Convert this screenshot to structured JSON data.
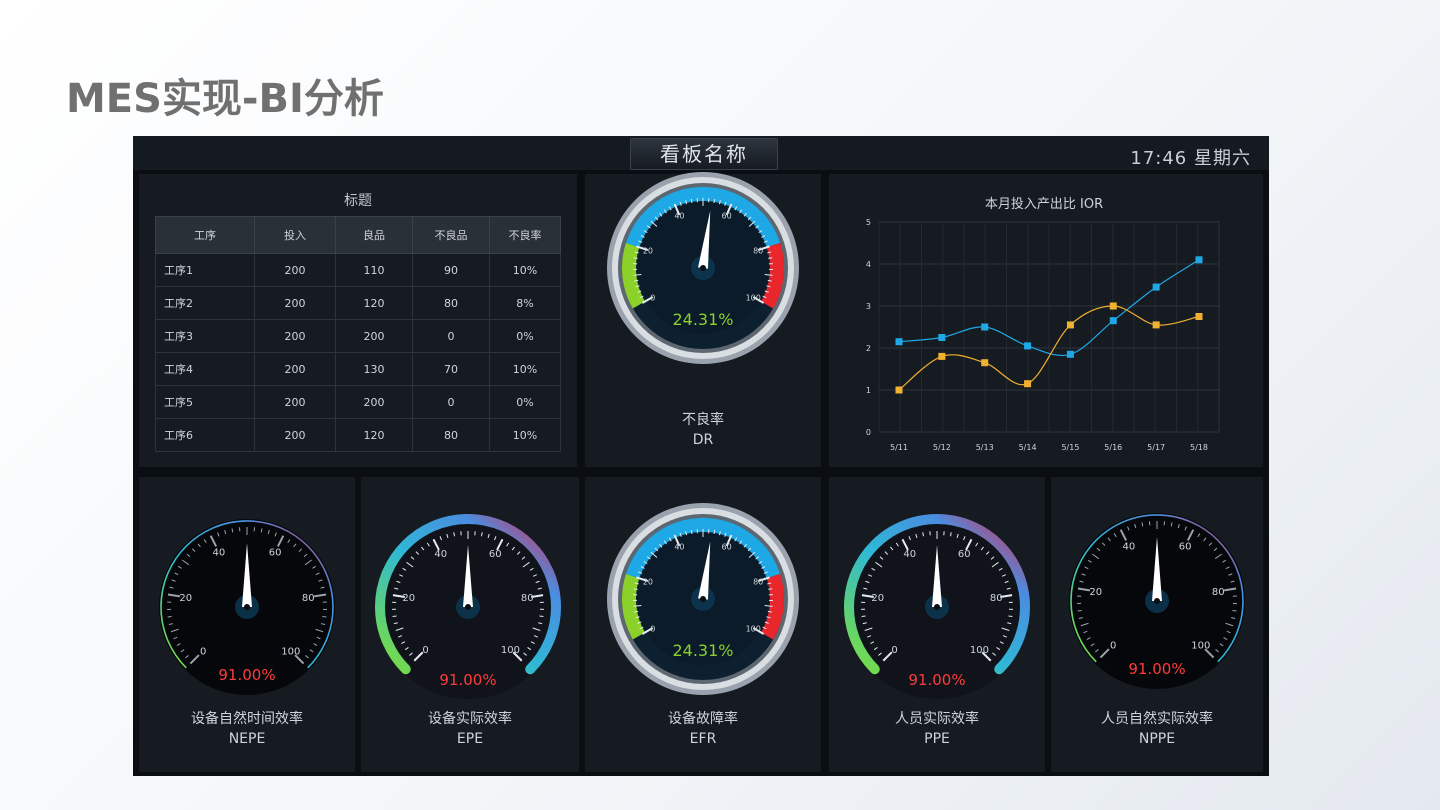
{
  "slide": {
    "title": "MES实现-BI分析"
  },
  "header": {
    "board_title": "看板名称",
    "clock": "17:46 星期六"
  },
  "table": {
    "title": "标题",
    "columns": [
      "工序",
      "投入",
      "良品",
      "不良品",
      "不良率"
    ],
    "rows": [
      [
        "工序1",
        "200",
        "110",
        "90",
        "10%"
      ],
      [
        "工序2",
        "200",
        "120",
        "80",
        "8%"
      ],
      [
        "工序3",
        "200",
        "200",
        "0",
        "0%"
      ],
      [
        "工序4",
        "200",
        "130",
        "70",
        "10%"
      ],
      [
        "工序5",
        "200",
        "200",
        "0",
        "0%"
      ],
      [
        "工序6",
        "200",
        "120",
        "80",
        "10%"
      ]
    ]
  },
  "gauges": {
    "dr": {
      "value_text": "24.31%",
      "value": 24.31,
      "label": "不良率",
      "code": "DR",
      "style": "dial"
    },
    "nepe": {
      "value_text": "91.00%",
      "value": 91.0,
      "label": "设备自然时间效率",
      "code": "NEPE",
      "style": "thin"
    },
    "epe": {
      "value_text": "91.00%",
      "value": 91.0,
      "label": "设备实际效率",
      "code": "EPE",
      "style": "arc"
    },
    "efr": {
      "value_text": "24.31%",
      "value": 24.31,
      "label": "设备故障率",
      "code": "EFR",
      "style": "dial"
    },
    "ppe": {
      "value_text": "91.00%",
      "value": 91.0,
      "label": "人员实际效率",
      "code": "PPE",
      "style": "arc"
    },
    "nppe": {
      "value_text": "91.00%",
      "value": 91.0,
      "label": "人员自然实际效率",
      "code": "NPPE",
      "style": "thin"
    }
  },
  "gauge_ticks": [
    "0",
    "20",
    "40",
    "60",
    "80",
    "100"
  ],
  "colors": {
    "blue": "#1fa8e6",
    "orange": "#f0b030",
    "green": "#8bd12a",
    "red": "#e8262b",
    "value_red": "#ff3b3b"
  },
  "chart_data": {
    "type": "line",
    "title": "本月投入产出比 IOR",
    "categories": [
      "5/11",
      "5/12",
      "5/13",
      "5/14",
      "5/15",
      "5/16",
      "5/17",
      "5/18"
    ],
    "series": [
      {
        "values": [
          2.15,
          2.25,
          2.5,
          2.05,
          1.85,
          2.65,
          3.45,
          4.1
        ],
        "color": "#1fa8e6"
      },
      {
        "values": [
          1.0,
          1.8,
          1.65,
          1.15,
          2.55,
          3.0,
          2.55,
          2.75
        ],
        "color": "#f0b030"
      }
    ],
    "y_ticks": [
      "0",
      "1",
      "2",
      "3",
      "4",
      "5"
    ],
    "ylim": [
      0,
      5
    ],
    "grid": true
  }
}
